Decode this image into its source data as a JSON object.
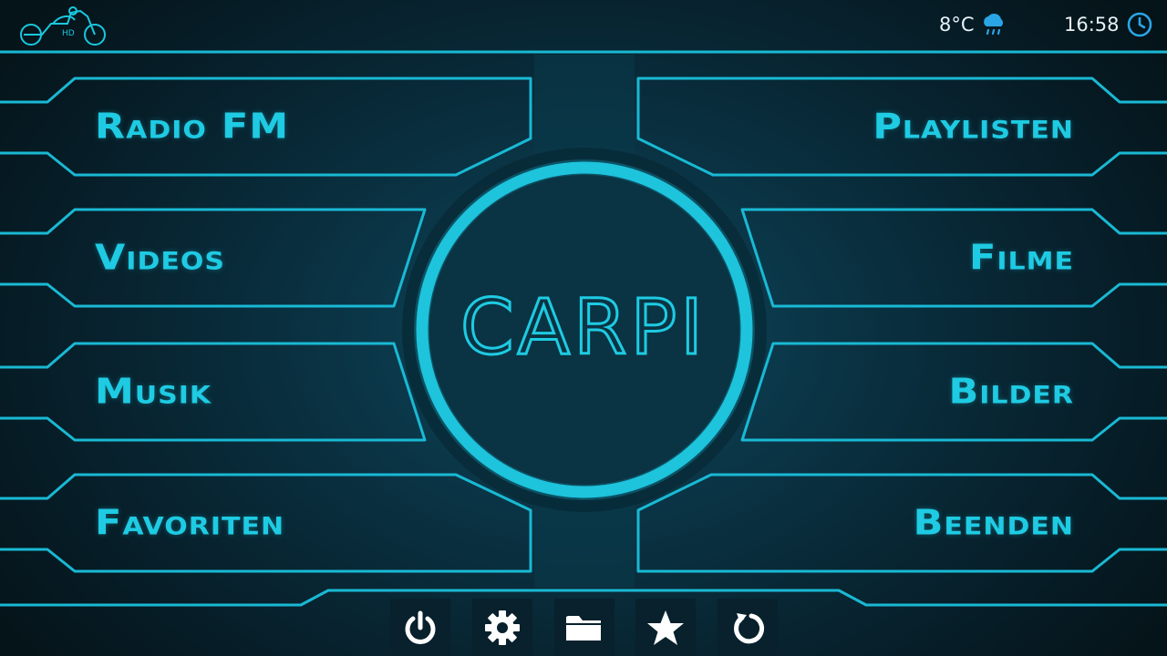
{
  "header": {
    "logo": "carpi-motorcycle-logo",
    "temperature": "8°C",
    "weather_icon": "cloud-rain-icon",
    "time": "16:58",
    "clock_icon": "clock-icon"
  },
  "center": {
    "logo_text": "CARPI"
  },
  "menu": {
    "left": [
      {
        "label": "Radio FM"
      },
      {
        "label": "Videos"
      },
      {
        "label": "Musik"
      },
      {
        "label": "Favoriten"
      }
    ],
    "right": [
      {
        "label": "Playlisten"
      },
      {
        "label": "Filme"
      },
      {
        "label": "Bilder"
      },
      {
        "label": "Beenden"
      }
    ]
  },
  "toolbar": [
    {
      "icon": "power-icon"
    },
    {
      "icon": "gear-icon"
    },
    {
      "icon": "folder-icon"
    },
    {
      "icon": "star-icon"
    },
    {
      "icon": "refresh-icon"
    }
  ],
  "colors": {
    "accent": "#19c8e0",
    "background": "#082633",
    "status_text": "#e6f2f5"
  }
}
